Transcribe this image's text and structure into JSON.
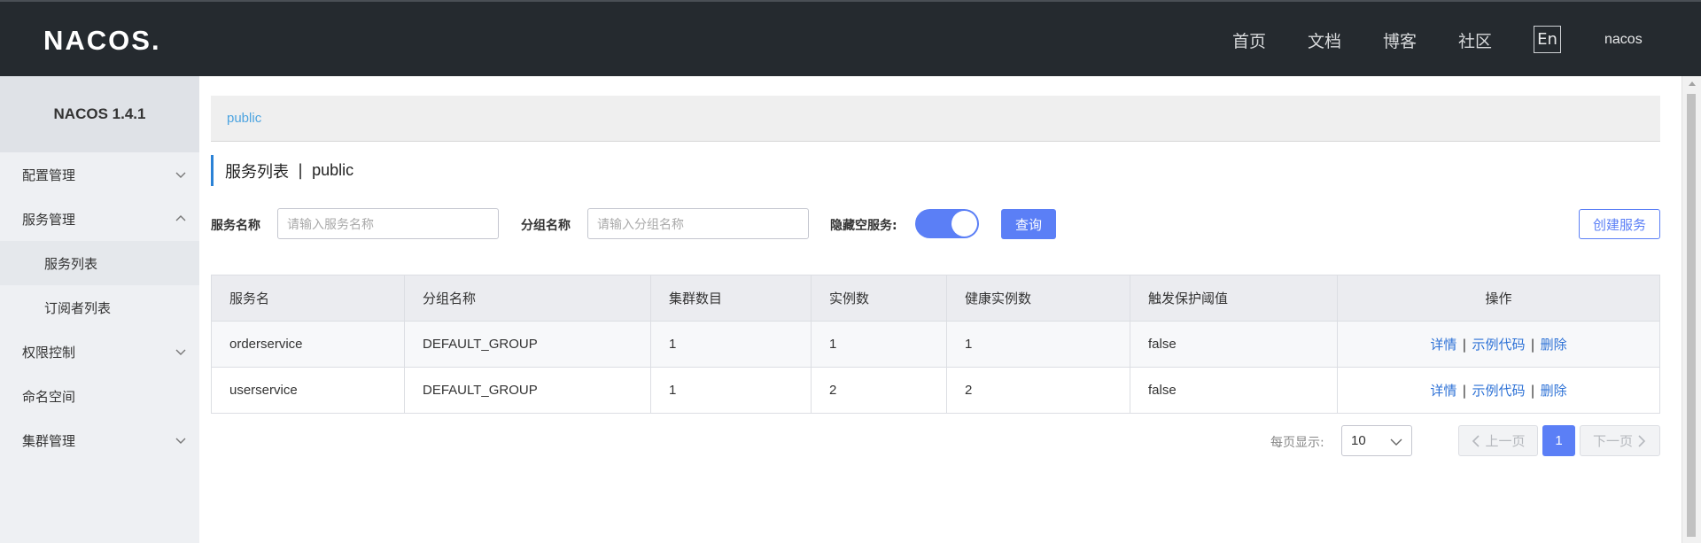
{
  "header": {
    "logo": "NACOS.",
    "nav": [
      "首页",
      "文档",
      "博客",
      "社区"
    ],
    "lang": "En",
    "user": "nacos"
  },
  "sidebar": {
    "title": "NACOS 1.4.1",
    "items": [
      {
        "label": "配置管理",
        "chevron": "down"
      },
      {
        "label": "服务管理",
        "chevron": "up"
      },
      {
        "label": "服务列表",
        "sub": true,
        "active": true
      },
      {
        "label": "订阅者列表",
        "sub": true
      },
      {
        "label": "权限控制",
        "chevron": "down"
      },
      {
        "label": "命名空间"
      },
      {
        "label": "集群管理",
        "chevron": "down"
      }
    ]
  },
  "breadcrumb": "public",
  "page_title": {
    "main": "服务列表",
    "sep": "|",
    "ns": "public"
  },
  "filters": {
    "service_name_label": "服务名称",
    "service_name_placeholder": "请输入服务名称",
    "group_name_label": "分组名称",
    "group_name_placeholder": "请输入分组名称",
    "hide_empty_label": "隐藏空服务:",
    "hide_empty_on": true,
    "query_label": "查询",
    "create_label": "创建服务"
  },
  "table": {
    "headers": [
      "服务名",
      "分组名称",
      "集群数目",
      "实例数",
      "健康实例数",
      "触发保护阈值",
      "操作"
    ],
    "rows": [
      [
        "orderservice",
        "DEFAULT_GROUP",
        "1",
        "1",
        "1",
        "false"
      ],
      [
        "userservice",
        "DEFAULT_GROUP",
        "1",
        "2",
        "2",
        "false"
      ]
    ],
    "ops": [
      "详情",
      "示例代码",
      "删除"
    ],
    "op_sep": "|"
  },
  "pagination": {
    "page_size_label": "每页显示:",
    "page_size": "10",
    "prev": "上一页",
    "current": "1",
    "next": "下一页"
  },
  "colors": {
    "primary": "#5b7ff6",
    "header_bg": "#252a2f",
    "link": "#2e72d6"
  }
}
